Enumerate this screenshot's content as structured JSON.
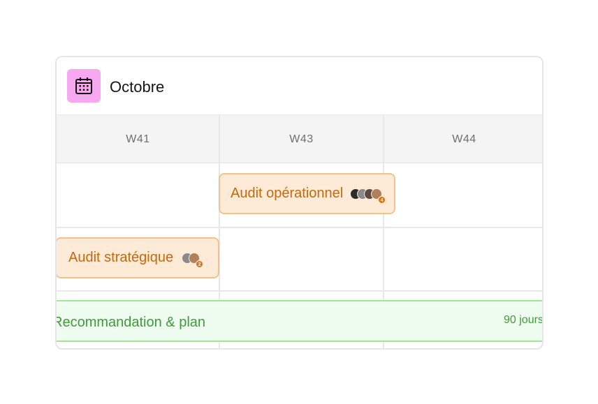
{
  "header": {
    "title": "Octobre",
    "icon": "calendar-icon",
    "icon_bg": "#f7a8f0"
  },
  "weeks": [
    "W41",
    "W43",
    "W44"
  ],
  "tasks": [
    {
      "label": "Audit opérationnel",
      "assignee_count": "4",
      "color": "#c4690e"
    },
    {
      "label": "Audit stratégique",
      "assignee_count": "2",
      "color": "#c4690e"
    }
  ],
  "phase": {
    "label": "Recommandation & plan",
    "duration": "90 jours",
    "color": "#3f9a3a"
  }
}
